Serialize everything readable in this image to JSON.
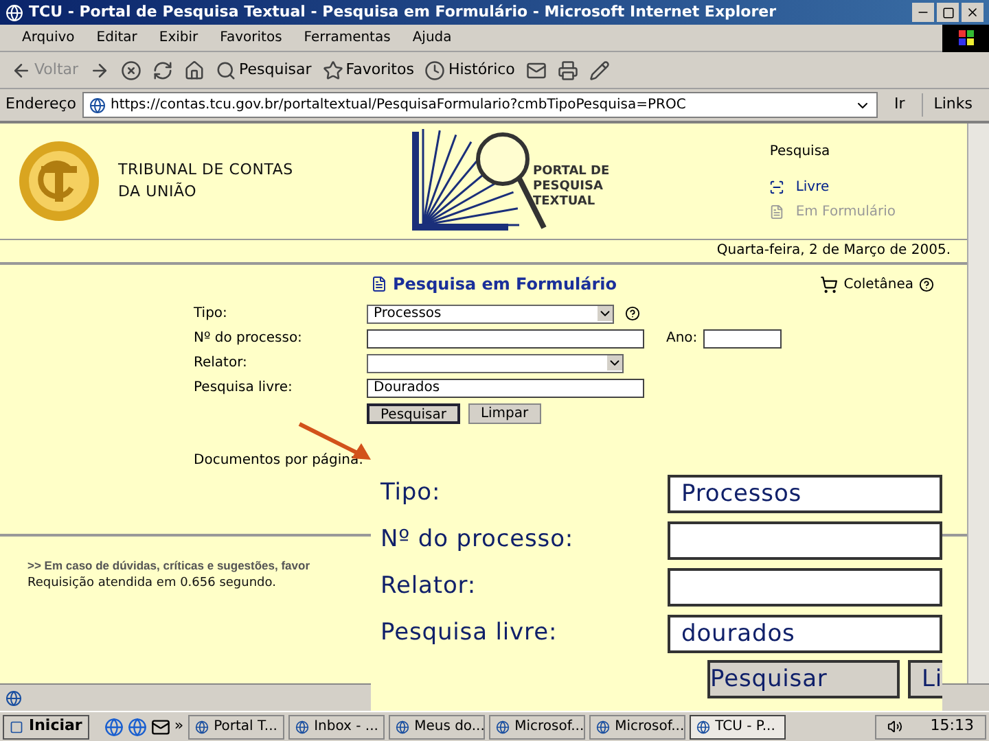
{
  "window": {
    "title": "TCU - Portal de Pesquisa Textual - Pesquisa em Formulário - Microsoft Internet Explorer"
  },
  "menu": [
    "Arquivo",
    "Editar",
    "Exibir",
    "Favoritos",
    "Ferramentas",
    "Ajuda"
  ],
  "toolbar": [
    {
      "kind": "back",
      "label": "Voltar"
    },
    {
      "kind": "forward"
    },
    {
      "kind": "stop"
    },
    {
      "kind": "refresh"
    },
    {
      "kind": "home"
    },
    {
      "kind": "search",
      "label": "Pesquisar"
    },
    {
      "kind": "favorites",
      "label": "Favoritos"
    },
    {
      "kind": "history",
      "label": "Histórico"
    },
    {
      "kind": "mail"
    },
    {
      "kind": "print"
    },
    {
      "kind": "edit"
    }
  ],
  "address": {
    "label": "Endereço",
    "url": "https://contas.tcu.gov.br/portaltextual/PesquisaFormulario?cmbTipoPesquisa=PROC",
    "go": "Ir",
    "links": "Links"
  },
  "header": {
    "org_lines": [
      "TRIBUNAL DE CONTAS",
      "DA UNIÃO"
    ],
    "portal_lines": [
      "PORTAL DE",
      "PESQUISA",
      "TEXTUAL"
    ],
    "search_title": "Pesquisa",
    "search_items": [
      {
        "label": "Livre",
        "selected": true
      },
      {
        "label": "Em Formulário",
        "selected": false
      }
    ],
    "date": "Quarta-feira, 2 de Março de 2005."
  },
  "form": {
    "title": "Pesquisa em Formulário",
    "collection": "Coletânea",
    "fields": [
      {
        "kind": "select",
        "label": "Tipo:",
        "value": "Processos",
        "help": true
      },
      {
        "kind": "text",
        "label": "Nº do processo:",
        "extra_label": "Ano:"
      },
      {
        "kind": "select",
        "label": "Relator:",
        "help": false
      },
      {
        "kind": "text",
        "label": "Pesquisa livre:",
        "value": "Dourados"
      }
    ],
    "buttons": [
      {
        "label": "Pesquisar",
        "selected": true
      },
      {
        "label": "Limpar",
        "selected": false
      }
    ],
    "per_page_label": "Documentos por página:"
  },
  "footer": {
    "notice": ">> Em caso de dúvidas, críticas e sugestões, favor",
    "timing": "Requisição atendida em 0.656 segundo."
  },
  "inset": {
    "fields": [
      {
        "label": "Tipo:",
        "value": "Processos"
      },
      {
        "label": "Nº do processo:"
      },
      {
        "label": "Relator:"
      },
      {
        "label": "Pesquisa livre:",
        "value": "dourados"
      }
    ],
    "buttons": [
      "Pesquisar",
      "Li"
    ]
  },
  "taskbar": {
    "start": "Iniciar",
    "more": "»",
    "tasks": [
      {
        "label": "Portal T...",
        "selected": false
      },
      {
        "label": "Inbox - ...",
        "selected": false
      },
      {
        "label": "Meus do...",
        "selected": false
      },
      {
        "label": "Microsof...",
        "selected": false
      },
      {
        "label": "Microsof...",
        "selected": false
      },
      {
        "label": "TCU - P...",
        "selected": true
      }
    ],
    "clock": "15:13"
  }
}
